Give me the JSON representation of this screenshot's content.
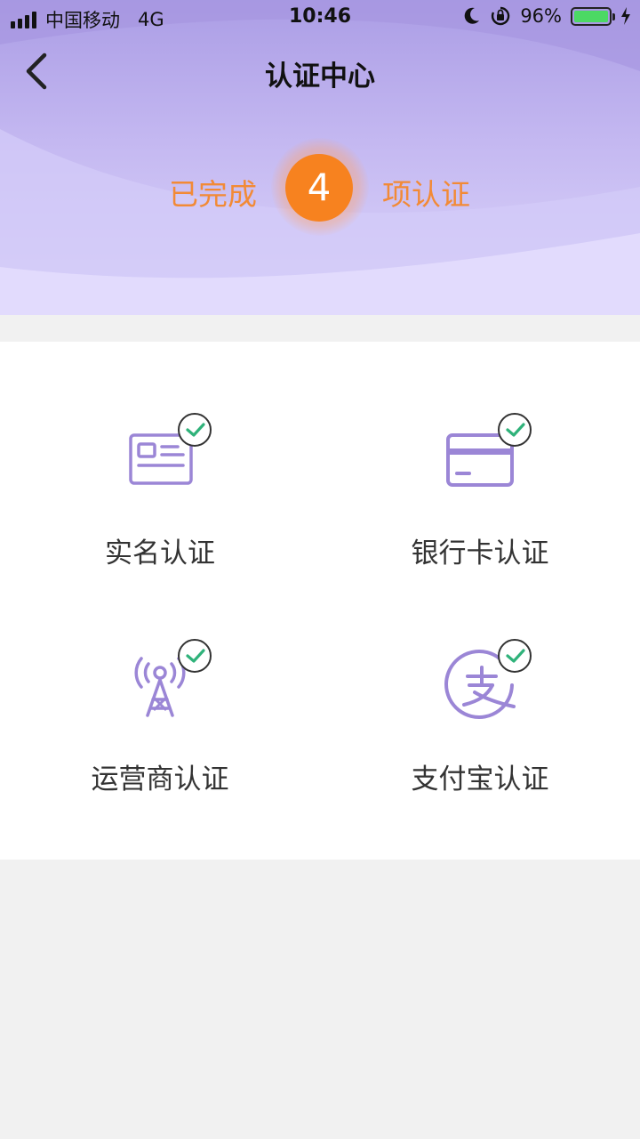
{
  "status_bar": {
    "carrier": "中国移动",
    "network": "4G",
    "time": "10:46",
    "battery": "96%"
  },
  "nav": {
    "title": "认证中心"
  },
  "summary": {
    "prefix": "已完成",
    "count": "4",
    "suffix": "项认证"
  },
  "items": [
    {
      "label": "实名认证",
      "icon": "id-card-icon",
      "verified": true
    },
    {
      "label": "银行卡认证",
      "icon": "bank-card-icon",
      "verified": true
    },
    {
      "label": "运营商认证",
      "icon": "signal-tower-icon",
      "verified": true
    },
    {
      "label": "支付宝认证",
      "icon": "alipay-icon",
      "verified": true
    }
  ],
  "colors": {
    "accent_purple": "#9b86d6",
    "count_orange": "#f7821f",
    "text_orange": "#f28a36",
    "check_green": "#2fb27a"
  }
}
